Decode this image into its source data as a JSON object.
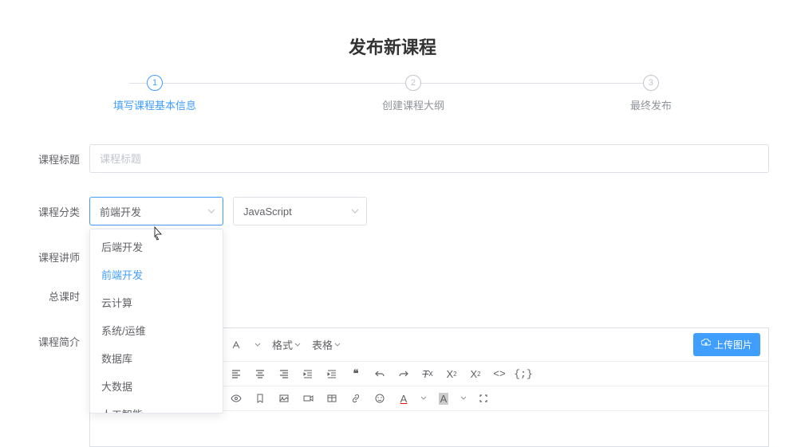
{
  "page_title": "发布新课程",
  "steps": [
    {
      "num": "1",
      "label": "填写课程基本信息"
    },
    {
      "num": "2",
      "label": "创建课程大纲"
    },
    {
      "num": "3",
      "label": "最终发布"
    }
  ],
  "form": {
    "title_label": "课程标题",
    "title_placeholder": "课程标题",
    "category_label": "课程分类",
    "category_value": "前端开发",
    "subcategory_value": "JavaScript",
    "category_options": [
      "后端开发",
      "前端开发",
      "云计算",
      "系统/运维",
      "数据库",
      "大数据",
      "人工智能"
    ],
    "teacher_label": "课程讲师",
    "hours_label": "总课时",
    "intro_label": "课程简介"
  },
  "editor": {
    "format_label": "格式",
    "table_label": "表格",
    "upload_label": "上传图片"
  }
}
